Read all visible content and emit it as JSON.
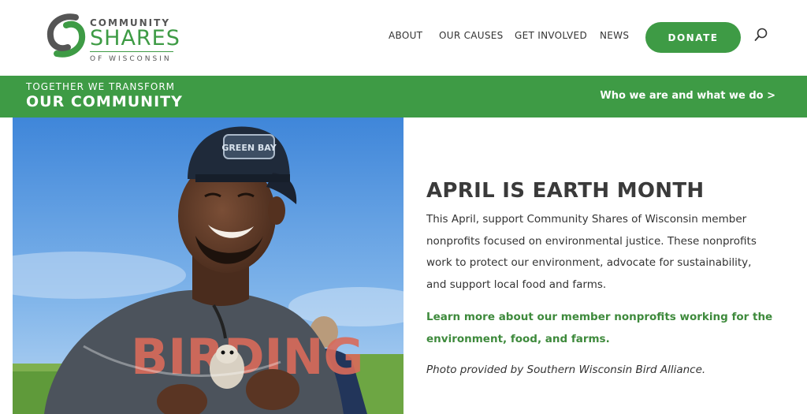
{
  "logo": {
    "line1": "COMMUNITY",
    "line2": "SHARES",
    "line3": "OF WISCONSIN"
  },
  "nav": {
    "items": [
      {
        "label": "ABOUT"
      },
      {
        "label": "OUR CAUSES"
      },
      {
        "label": "GET INVOLVED"
      },
      {
        "label": "NEWS"
      }
    ],
    "donate_label": "DONATE"
  },
  "band": {
    "subtitle": "TOGETHER WE TRANSFORM",
    "title": "OUR COMMUNITY",
    "link": "Who we are and what we do >"
  },
  "photo": {
    "hat_text": "GREEN BAY",
    "shirt_text": "BIRDING"
  },
  "article": {
    "headline": "APRIL IS EARTH MONTH",
    "body": "This April, support Community Shares of Wisconsin member nonprofits focused on environmental justice. These nonprofits work to protect our environment, advocate for sustainability, and support local food and farms.",
    "learn_more": "Learn more about our member nonprofits working for the environment, food, and farms.",
    "credit": "Photo provided by Southern Wisconsin Bird Alliance."
  },
  "colors": {
    "brand_green": "#3e9b45",
    "link_green": "#3e8a3c"
  }
}
